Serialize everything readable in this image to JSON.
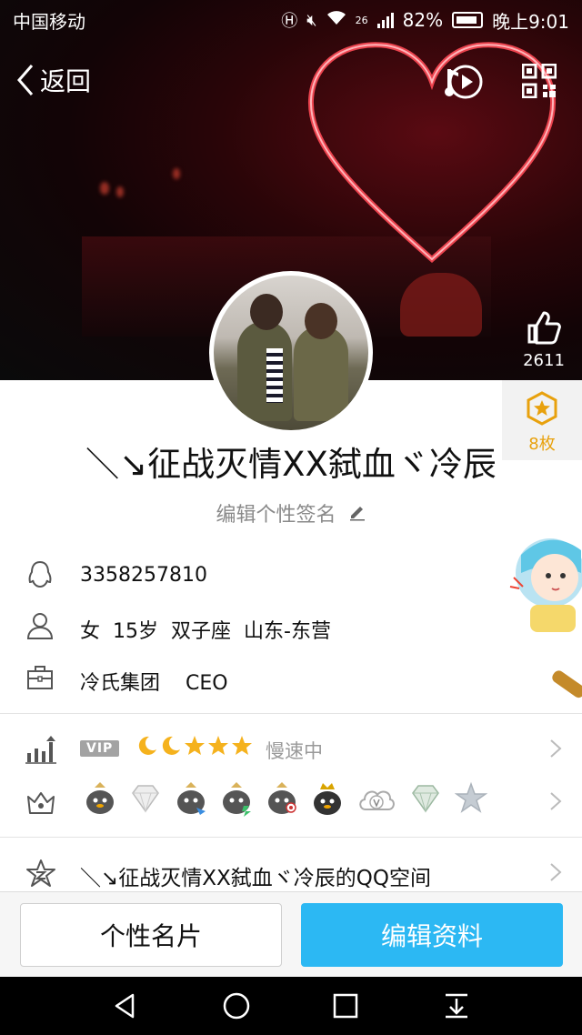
{
  "status_bar": {
    "carrier": "中国移动",
    "network": "26",
    "battery": "82%",
    "time": "晚上9:01"
  },
  "nav": {
    "back_label": "返回"
  },
  "likes": {
    "count": "2611"
  },
  "medals": {
    "count": "8枚"
  },
  "profile": {
    "nickname": "＼↘征战灭情XX弑血ヾ冷辰",
    "signature_prompt": "编辑个性签名",
    "qq_number": "3358257810",
    "gender": "女",
    "age": "15岁",
    "zodiac": "双子座",
    "location": "山东-东营",
    "company": "冷氏集团",
    "title": "CEO"
  },
  "vip_row": {
    "badge": "VIP",
    "level_icons": [
      "moon",
      "moon",
      "star",
      "star",
      "star"
    ],
    "speed_status": "慢速中"
  },
  "badges_row": {
    "icons": [
      "penguin-gold",
      "diamond",
      "penguin-blue",
      "penguin-green",
      "penguin-eye",
      "penguin-crown",
      "cloud-v",
      "diamond-green",
      "star-gray"
    ]
  },
  "qzone_row": {
    "label": "＼↘征战灭情XX弑血ヾ冷辰的QQ空间"
  },
  "actions": {
    "card_label": "个性名片",
    "edit_label": "编辑资料"
  },
  "colors": {
    "accent": "#2cb8f3",
    "medal": "#e8a10d"
  }
}
